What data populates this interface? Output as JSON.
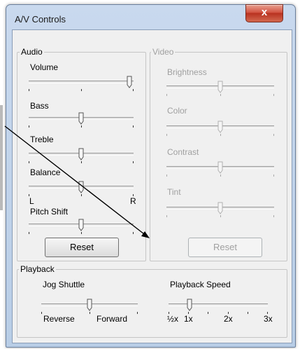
{
  "window": {
    "title": "A/V Controls",
    "close_label": "x"
  },
  "audio": {
    "group_label": "Audio",
    "volume_label": "Volume",
    "bass_label": "Bass",
    "treble_label": "Treble",
    "balance_label": "Balance",
    "balance_left": "L",
    "balance_right": "R",
    "pitch_label": "Pitch Shift",
    "reset_label": "Reset",
    "volume_level": 0.98,
    "bass_level": 0.5,
    "treble_level": 0.5,
    "balance_level": 0.5,
    "pitch_level": 0.5
  },
  "video": {
    "group_label": "Video",
    "brightness_label": "Brightness",
    "color_label": "Color",
    "contrast_label": "Contrast",
    "tint_label": "Tint",
    "reset_label": "Reset",
    "brightness_level": 0.5,
    "color_level": 0.5,
    "contrast_level": 0.5,
    "tint_level": 0.5
  },
  "playback": {
    "group_label": "Playback",
    "jog_label": "Jog Shuttle",
    "jog_reverse": "Reverse",
    "jog_forward": "Forward",
    "jog_level": 0.5,
    "speed_label": "Playback Speed",
    "speed_ticks": [
      "½x",
      "1x",
      "2x",
      "3x"
    ],
    "speed_value": "1x"
  },
  "colors": {
    "accent": "#c3432f",
    "window_border": "#6a7f9c",
    "face": "#f0f0f0"
  }
}
